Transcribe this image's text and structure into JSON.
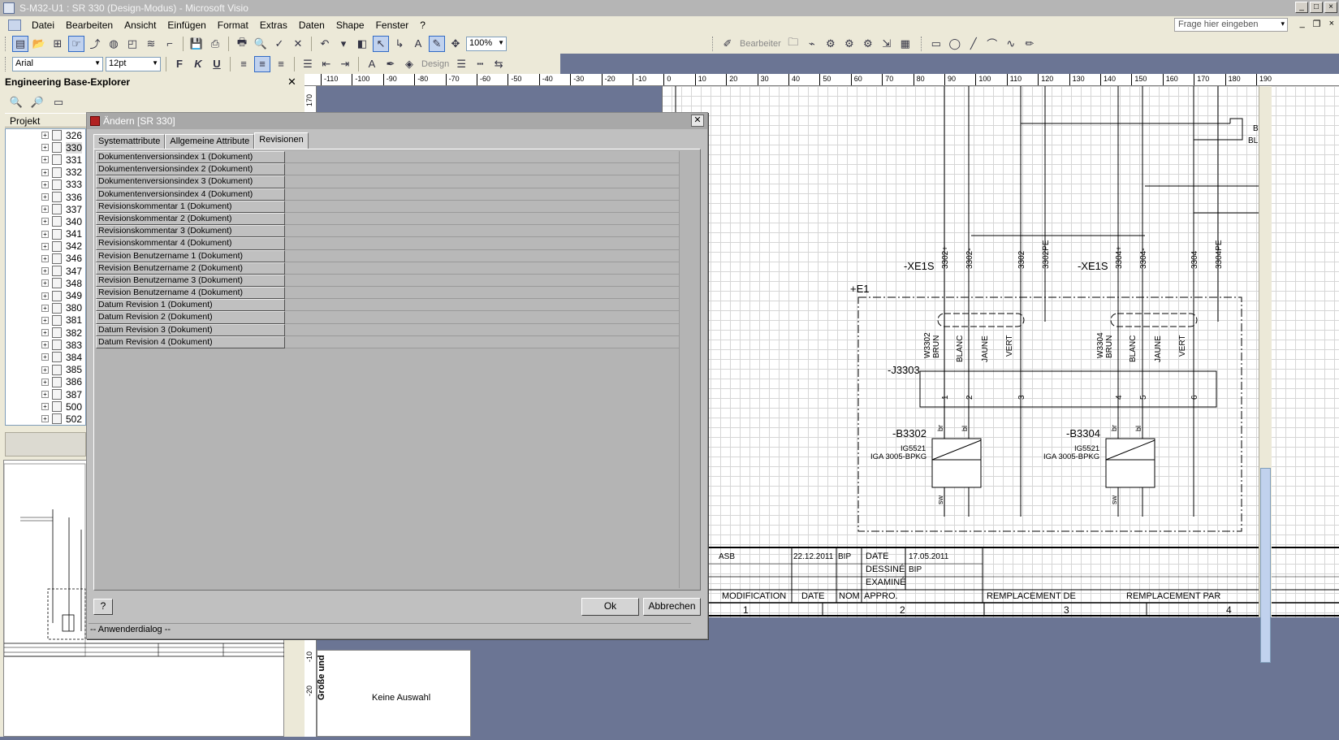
{
  "window": {
    "title": "S-M32-U1 : SR 330 (Design-Modus) - Microsoft Visio"
  },
  "menu": {
    "items": [
      "Datei",
      "Bearbeiten",
      "Ansicht",
      "Einfügen",
      "Format",
      "Extras",
      "Daten",
      "Shape",
      "Fenster",
      "?"
    ],
    "help_placeholder": "Frage hier eingeben"
  },
  "toolbar": {
    "zoom": "100%",
    "font": "Arial",
    "font_size": "12pt",
    "bearbeiter_label": "Bearbeiter",
    "design_label": "Design"
  },
  "explorer": {
    "title": "Engineering Base-Explorer",
    "tree_header": "Projekt",
    "items": [
      "326",
      "330",
      "331",
      "332",
      "333",
      "336",
      "337",
      "340",
      "341",
      "342",
      "346",
      "347",
      "348",
      "349",
      "380",
      "381",
      "382",
      "383",
      "384",
      "385",
      "386",
      "387",
      "500",
      "502"
    ],
    "selected": "330"
  },
  "ruler": {
    "top_ticks": [
      "-110",
      "-100",
      "-90",
      "-80",
      "-70",
      "-60",
      "-50",
      "-40",
      "-30",
      "-20",
      "-10",
      "0",
      "10",
      "20",
      "30",
      "40",
      "50",
      "60",
      "70",
      "80",
      "90",
      "100",
      "110",
      "120",
      "130",
      "140",
      "150",
      "160",
      "170",
      "180",
      "190"
    ],
    "left_ticks": [
      "170",
      "-10",
      "-20"
    ]
  },
  "dialog": {
    "title": "Ändern [SR 330]",
    "tabs": [
      "Systemattribute",
      "Allgemeine Attribute",
      "Revisionen"
    ],
    "active_tab": "Revisionen",
    "rows": [
      "Dokumentenversionsindex 1 (Dokument)",
      "Dokumentenversionsindex 2 (Dokument)",
      "Dokumentenversionsindex 3 (Dokument)",
      "Dokumentenversionsindex 4 (Dokument)",
      "Revisionskommentar 1 (Dokument)",
      "Revisionskommentar 2 (Dokument)",
      "Revisionskommentar 3 (Dokument)",
      "Revisionskommentar 4 (Dokument)",
      "Revision Benutzername 1 (Dokument)",
      "Revision Benutzername 2 (Dokument)",
      "Revision Benutzername 3 (Dokument)",
      "Revision Benutzername 4 (Dokument)",
      "Datum Revision 1 (Dokument)",
      "Datum Revision 2 (Dokument)",
      "Datum Revision 3 (Dokument)",
      "Datum Revision 4 (Dokument)"
    ],
    "help_label": "?",
    "ok_label": "Ok",
    "cancel_label": "Abbrechen",
    "status": "-- Anwenderdialog --"
  },
  "drawing": {
    "connectors": [
      "-XE1S",
      "-XE1S"
    ],
    "pins_left": [
      "3302+",
      "3302-",
      "3302",
      "3302PE"
    ],
    "pins_right": [
      "3304+",
      "3304-",
      "3304",
      "3304PE"
    ],
    "frame_label": "+E1",
    "cable_left": [
      "W3302",
      "BRUN",
      "BLANC",
      "JAUNE",
      "VERT"
    ],
    "cable_right": [
      "W3304",
      "BRUN",
      "BLANC",
      "JAUNE",
      "VERT"
    ],
    "junction": "-J3303",
    "j_pins": [
      "1",
      "2",
      "3",
      "4",
      "5",
      "6"
    ],
    "sensor_left": {
      "tag": "-B3302",
      "type": "IG5521",
      "part": "IGA 3005-BPKG"
    },
    "sensor_right": {
      "tag": "-B3304",
      "type": "IG5521",
      "part": "IGA 3005-BPKG"
    },
    "wire_labels": [
      "br",
      "bl",
      "sw"
    ],
    "right_edge": [
      "BR",
      "BL"
    ],
    "title_block": {
      "asb": "ASB",
      "rev_date": "22.12.2011",
      "rev_by": "BIP",
      "date_label": "DATE",
      "date_value": "17.05.2011",
      "dessine_label": "DESSINÉ",
      "dessine_value": "BIP",
      "examine_label": "EXAMINÉ",
      "modification": "MODIFICATION",
      "date_col": "DATE",
      "nom_col": "NOM",
      "appro_col": "APPRO.",
      "remplacement_de": "REMPLACEMENT DE",
      "remplacement_par": "REMPLACEMENT PAR",
      "columns": [
        "1",
        "2",
        "3",
        "4"
      ]
    },
    "side_panel_label": "Größe und",
    "no_selection": "Keine Auswahl"
  }
}
